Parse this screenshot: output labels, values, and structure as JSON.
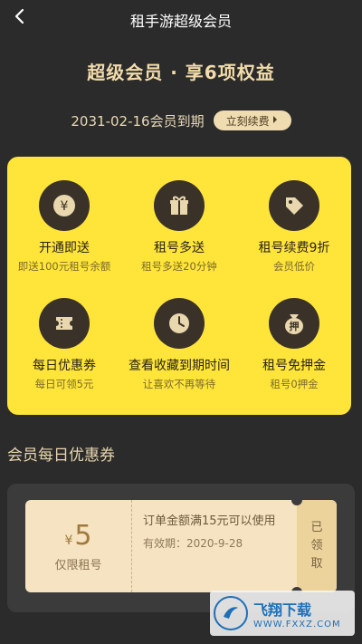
{
  "header": {
    "title": "租手游超级会员",
    "back_icon": "chevron-left-icon"
  },
  "hero": {
    "title": "超级会员 · 享6项权益"
  },
  "membership": {
    "expiry_text": "2031-02-16会员到期",
    "renew_label": "立刻续费"
  },
  "benefits": [
    {
      "icon": "yen-icon",
      "title": "开通即送",
      "subtitle": "即送100元租号余额"
    },
    {
      "icon": "gift-icon",
      "title": "租号多送",
      "subtitle": "租号多送20分钟"
    },
    {
      "icon": "tag-icon",
      "title": "租号续费9折",
      "subtitle": "会员低价"
    },
    {
      "icon": "ticket-icon",
      "title": "每日优惠券",
      "subtitle": "每日可领5元"
    },
    {
      "icon": "clock-icon",
      "title": "查看收藏到期时间",
      "subtitle": "让喜欢不再等待"
    },
    {
      "icon": "deposit-bag-icon",
      "title": "租号免押金",
      "subtitle": "租号0押金",
      "icon_text": "押"
    }
  ],
  "daily_coupon": {
    "section_title": "会员每日优惠券",
    "currency": "¥",
    "amount": "5",
    "scope": "仅限租号",
    "condition": "订单金额满15元可以使用",
    "validity": "有效期：2020-9-28",
    "status": "已领取"
  },
  "watermark": {
    "title": "飞翔下载",
    "url": "WWW.FXXZ.COM"
  },
  "colors": {
    "accent_gold": "#f3dcaa",
    "panel_yellow": "#ffe53a",
    "background": "#2b2b2b"
  }
}
